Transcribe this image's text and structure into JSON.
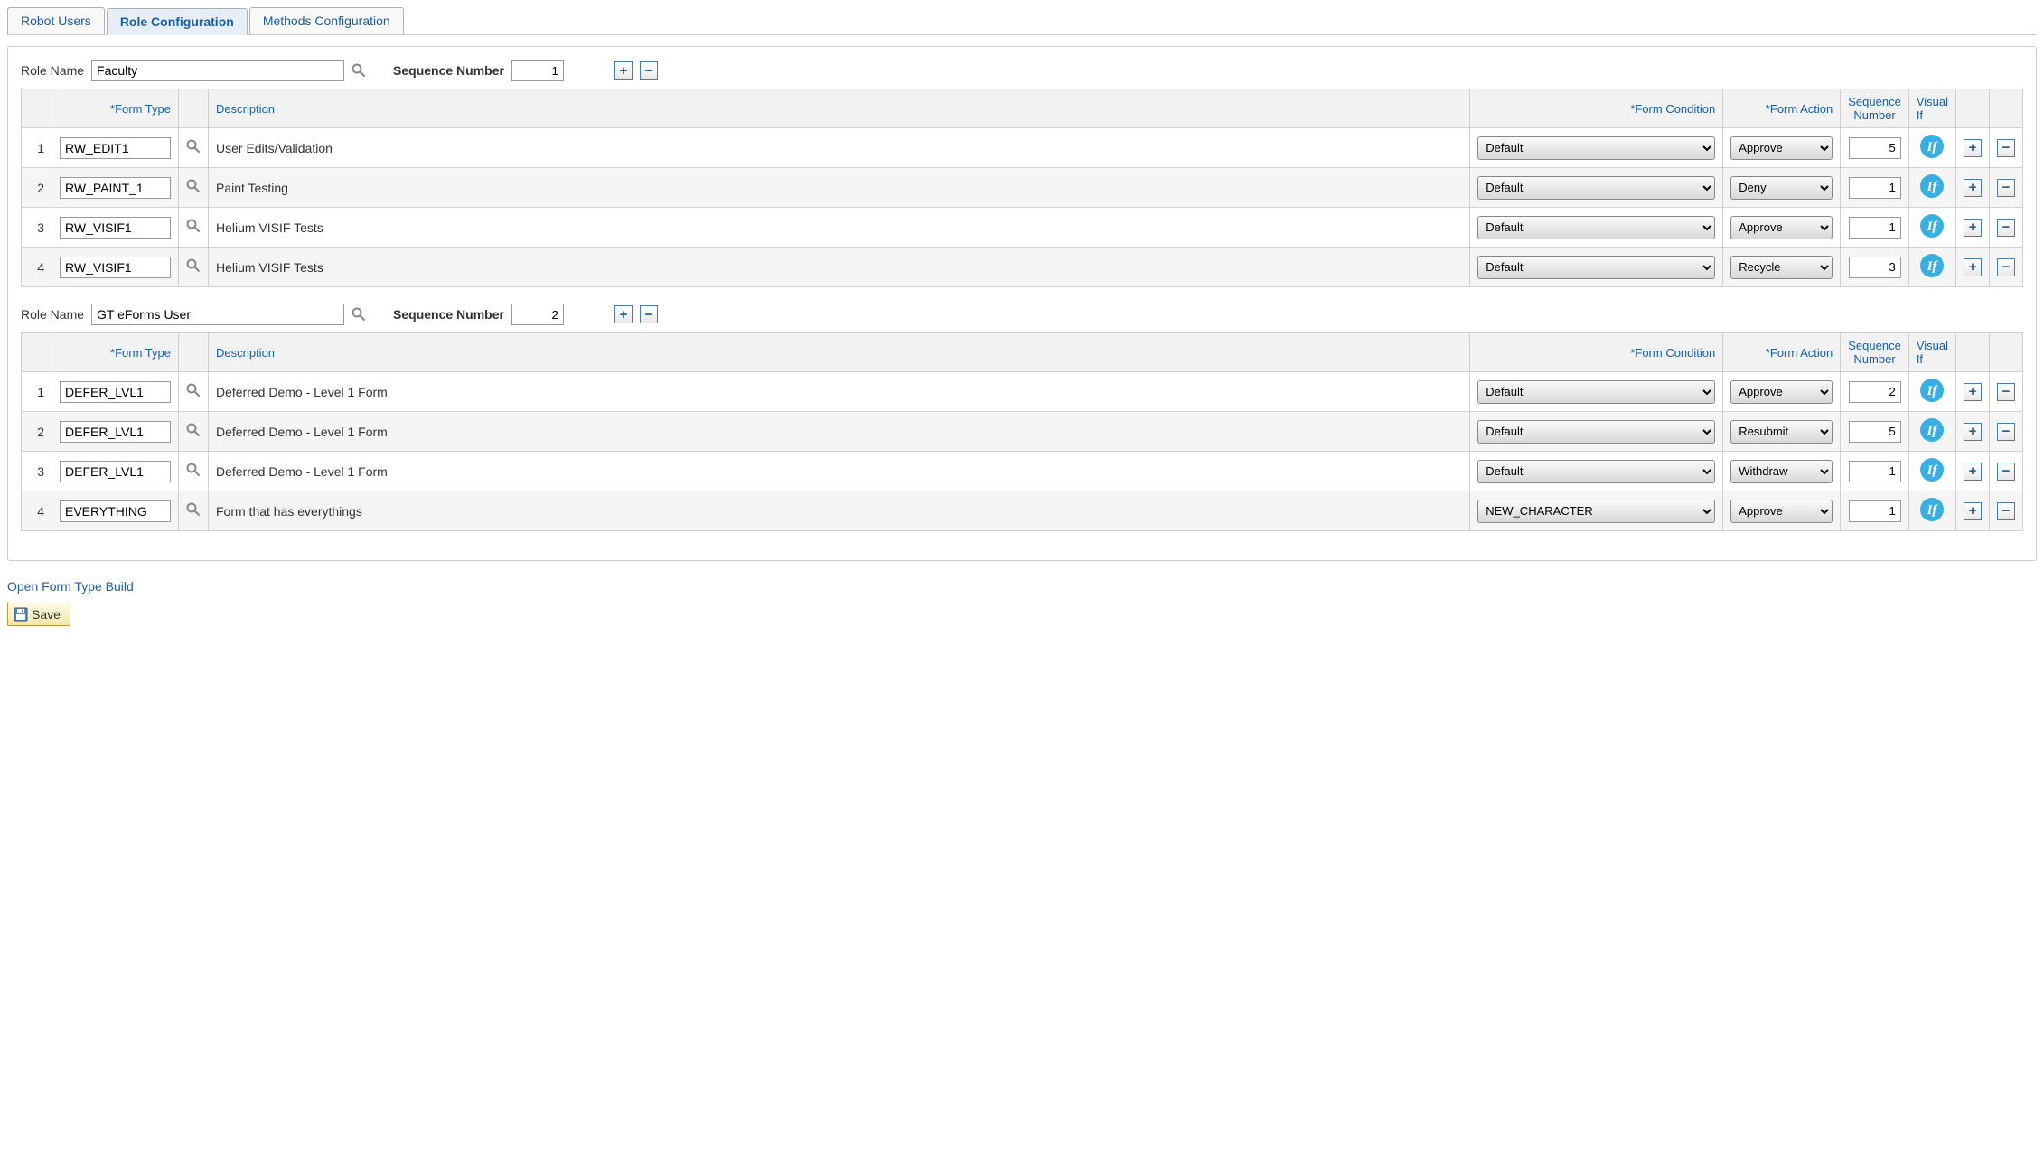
{
  "tabs": [
    {
      "label": "Robot Users",
      "active": false
    },
    {
      "label": "Role Configuration",
      "active": true
    },
    {
      "label": "Methods Configuration",
      "active": false
    }
  ],
  "labels": {
    "role_name": "Role Name",
    "sequence_number": "Sequence Number",
    "form_type": "*Form Type",
    "description": "Description",
    "form_condition": "*Form Condition",
    "form_action": "*Form Action",
    "seq_num": "Sequence Number",
    "visual_if": "Visual If",
    "open_form_type_build": "Open Form Type Build",
    "save": "Save"
  },
  "roles": [
    {
      "role_name": "Faculty",
      "sequence": "1",
      "rows": [
        {
          "form_type": "RW_EDIT1",
          "description": "User Edits/Validation",
          "condition": "Default",
          "action": "Approve",
          "seq": "5"
        },
        {
          "form_type": "RW_PAINT_1",
          "description": "Paint Testing",
          "condition": "Default",
          "action": "Deny",
          "seq": "1"
        },
        {
          "form_type": "RW_VISIF1",
          "description": "Helium VISIF Tests",
          "condition": "Default",
          "action": "Approve",
          "seq": "1"
        },
        {
          "form_type": "RW_VISIF1",
          "description": "Helium VISIF Tests",
          "condition": "Default",
          "action": "Recycle",
          "seq": "3"
        }
      ]
    },
    {
      "role_name": "GT eForms User",
      "sequence": "2",
      "rows": [
        {
          "form_type": "DEFER_LVL1",
          "description": "Deferred Demo - Level 1 Form",
          "condition": "Default",
          "action": "Approve",
          "seq": "2"
        },
        {
          "form_type": "DEFER_LVL1",
          "description": "Deferred Demo - Level 1 Form",
          "condition": "Default",
          "action": "Resubmit",
          "seq": "5"
        },
        {
          "form_type": "DEFER_LVL1",
          "description": "Deferred Demo - Level 1 Form",
          "condition": "Default",
          "action": "Withdraw",
          "seq": "1"
        },
        {
          "form_type": "EVERYTHING",
          "description": "Form that has everythings",
          "condition": "NEW_CHARACTER",
          "action": "Approve",
          "seq": "1"
        }
      ]
    }
  ]
}
